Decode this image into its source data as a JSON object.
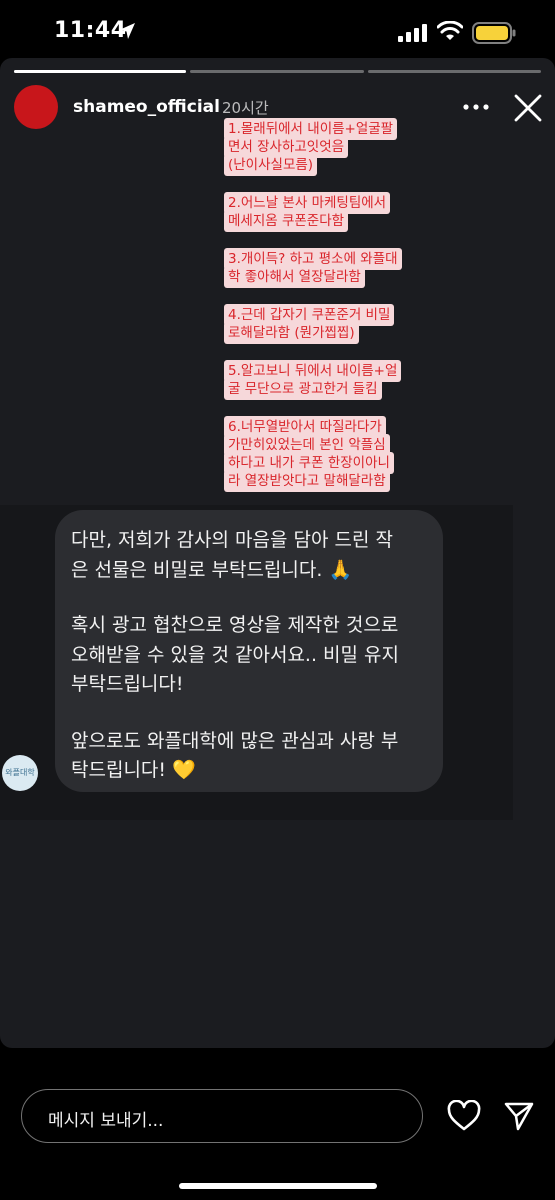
{
  "status_bar": {
    "time": "11:44",
    "icons": [
      "location-arrow-icon",
      "cellular-signal-icon",
      "wifi-icon",
      "battery-icon"
    ],
    "battery_color": "#f7d23a"
  },
  "story": {
    "progress_segments": [
      1.0,
      0.0,
      0.0
    ],
    "username": "shameo_official",
    "time_ago": "20시간",
    "avatar_color": "#c8161b",
    "notes": [
      "1.몰래뒤에서 내이름+얼굴팔",
      "면서 장사하고잇엇음",
      "(난이사실모름)",
      "2.어느날 본사 마케팅팀에서",
      "메세지옴 쿠폰준다함",
      "3.개이득? 하고 평소에 와플대",
      "학 좋아해서 열장달라함",
      "4.근데 갑자기 쿠폰준거 비밀",
      "로해달라함 (뭔가찝찝)",
      "5.알고보니 뒤에서 내이름+얼",
      "굴 무단으로 광고한거 들킴",
      "6.너무열받아서 따질라다가",
      "가만히있었는데 본인 악플심",
      "하다고 내가 쿠폰 한장이아니",
      "라 열장받앗다고 말해달라함"
    ],
    "note_colors": {
      "background": "#f6d8da",
      "text": "#d9262c"
    }
  },
  "message": {
    "sender_avatar_text": "와플대학",
    "lines": [
      "다만, 저희가 감사의 마음을 담아 드린 작",
      "은 선물은 비밀로 부탁드립니다. 🙏",
      "혹시 광고 협찬으로 영상을 제작한 것으로",
      "오해받을 수 있을 것 같아서요.. 비밀 유지",
      "부탁드립니다!",
      "앞으로도 와플대학에 많은 관심과 사랑 부",
      "탁드립니다! 💛"
    ]
  },
  "bottom_bar": {
    "input_placeholder": "메시지 보내기..."
  }
}
